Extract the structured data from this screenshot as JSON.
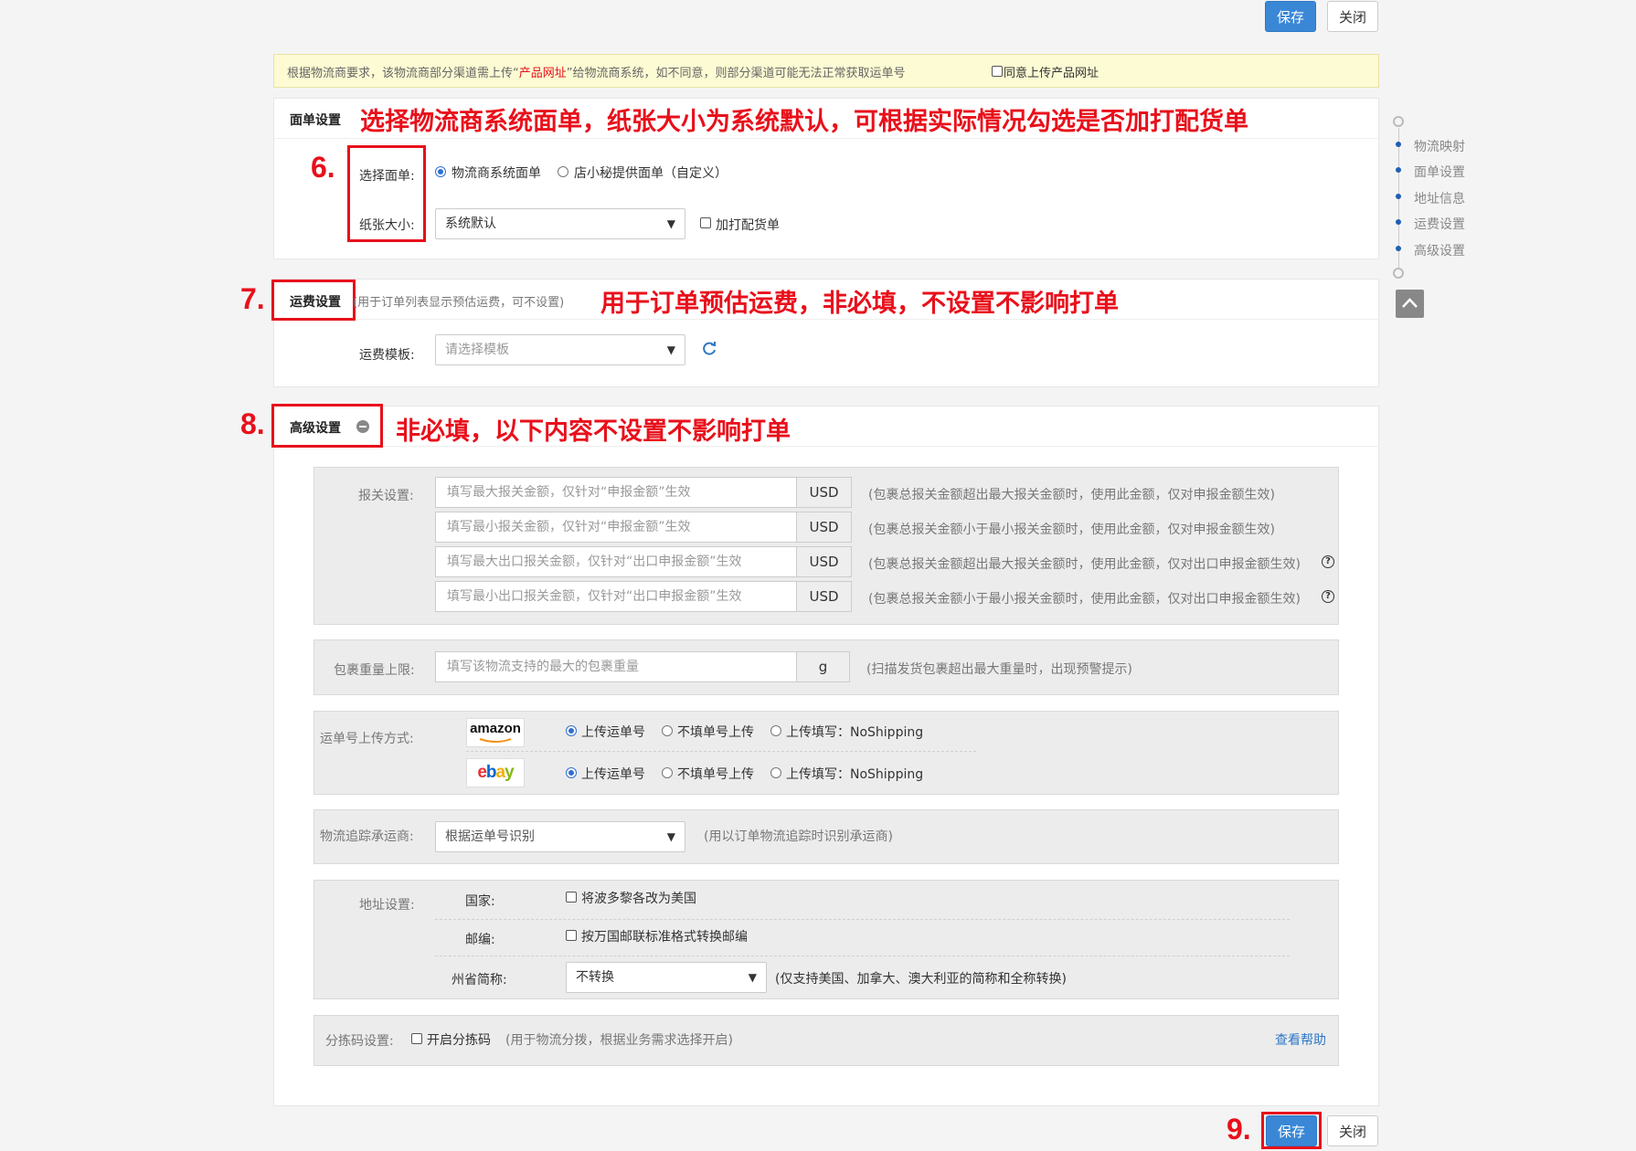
{
  "top_buttons": {
    "save": "保存",
    "close": "关闭"
  },
  "notice": {
    "pre": "根据物流商要求，该物流商部分渠道需上传“",
    "highlight": "产品网址",
    "post": "”给物流商系统，如不同意，则部分渠道可能无法正常获取运单号",
    "checkbox_label": "同意上传产品网址"
  },
  "label_section": {
    "title": "面单设置",
    "annotation": "选择物流商系统面单，纸张大小为系统默认，可根据实际情况勾选是否加打配货单",
    "marker": "6.",
    "select_label": "选择面单:",
    "option1": "物流商系统面单",
    "option2": "店小秘提供面单（自定义）",
    "paper_label": "纸张大小:",
    "paper_value": "系统默认",
    "print_pick_label": "加打配货单"
  },
  "freight_section": {
    "marker": "7.",
    "title": "运费设置",
    "hint": "(用于订单列表显示预估运费，可不设置)",
    "annotation": "用于订单预估运费，非必填，不设置不影响打单",
    "template_label": "运费模板:",
    "template_placeholder": "请选择模板",
    "refresh_icon": "refresh-icon"
  },
  "advanced_section": {
    "marker": "8.",
    "title": "高级设置",
    "annotation": "非必填，以下内容不设置不影响打单",
    "customs": {
      "label": "报关设置:",
      "rows": [
        {
          "placeholder": "填写最大报关金额，仅针对“申报金额”生效",
          "unit": "USD",
          "hint": "(包裹总报关金额超出最大报关金额时，使用此金额，仅对申报金额生效)"
        },
        {
          "placeholder": "填写最小报关金额，仅针对“申报金额”生效",
          "unit": "USD",
          "hint": "(包裹总报关金额小于最小报关金额时，使用此金额，仅对申报金额生效)"
        },
        {
          "placeholder": "填写最大出口报关金额，仅针对“出口申报金额”生效",
          "unit": "USD",
          "hint": "(包裹总报关金额超出最大报关金额时，使用此金额，仅对出口申报金额生效)"
        },
        {
          "placeholder": "填写最小出口报关金额，仅针对“出口申报金额”生效",
          "unit": "USD",
          "hint": "(包裹总报关金额小于最小报关金额时，使用此金额，仅对出口申报金额生效)"
        }
      ]
    },
    "weight": {
      "label": "包裹重量上限:",
      "placeholder": "填写该物流支持的最大的包裹重量",
      "unit": "g",
      "hint": "(扫描发货包裹超出最大重量时，出现预警提示)"
    },
    "upload": {
      "label": "运单号上传方式:",
      "platforms": [
        {
          "name": "amazon",
          "options": [
            "上传运单号",
            "不填单号上传",
            "上传填写：NoShipping"
          ]
        },
        {
          "name": "ebay",
          "options": [
            "上传运单号",
            "不填单号上传",
            "上传填写：NoShipping"
          ]
        }
      ]
    },
    "tracking": {
      "label": "物流追踪承运商:",
      "value": "根据运单号识别",
      "hint": "(用以订单物流追踪时识别承运商)"
    },
    "address": {
      "label": "地址设置:",
      "country_label": "国家:",
      "country_option": "将波多黎各改为美国",
      "zip_label": "邮编:",
      "zip_option": "按万国邮联标准格式转换邮编",
      "state_label": "州省简称:",
      "state_value": "不转换",
      "state_hint": "(仅支持美国、加拿大、澳大利亚的简称和全称转换)"
    },
    "sort": {
      "label": "分拣码设置:",
      "option": "开启分拣码",
      "hint": "(用于物流分拨，根据业务需求选择开启)",
      "help_link": "查看帮助"
    }
  },
  "side_nav": {
    "items": [
      "物流映射",
      "面单设置",
      "地址信息",
      "运费设置",
      "高级设置"
    ]
  },
  "bottom_buttons": {
    "marker": "9.",
    "save": "保存",
    "close": "关闭"
  }
}
